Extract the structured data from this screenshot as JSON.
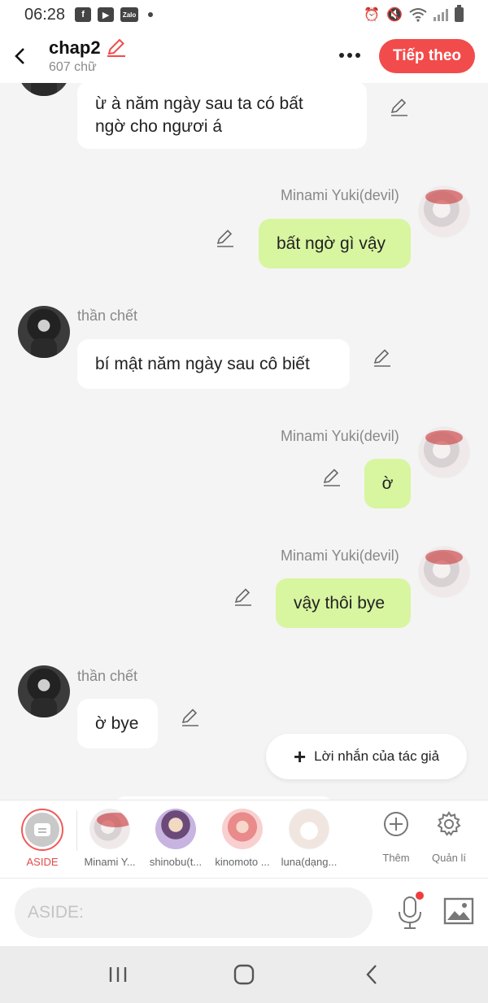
{
  "status_bar": {
    "time": "06:28",
    "apps": [
      "facebook-icon",
      "youtube-icon",
      "zalo-icon"
    ],
    "zalo_text": "Zalo"
  },
  "header": {
    "title": "chap2",
    "word_count": "607 chữ",
    "next_label": "Tiếp theo",
    "accent_color": "#f24b4b"
  },
  "messages": [
    {
      "side": "left",
      "sender": "",
      "text_line1": "ừ à năm ngày sau ta có bất",
      "text_line2": "ngờ cho ngươi á"
    },
    {
      "side": "right",
      "sender": "Minami Yuki(devil)",
      "text": "bất ngờ gì vậy"
    },
    {
      "side": "left",
      "sender": "thần chết",
      "text": "bí mật năm ngày sau cô biết"
    },
    {
      "side": "right",
      "sender": "Minami Yuki(devil)",
      "text": "ờ"
    },
    {
      "side": "right",
      "sender": "Minami Yuki(devil)",
      "text": "vậy thôi bye"
    },
    {
      "side": "left",
      "sender": "thần chết",
      "text": "ờ bye"
    }
  ],
  "author_note": {
    "label": "Lời nhắn của tác giả"
  },
  "character_bar": {
    "aside_label": "ASIDE",
    "characters": [
      {
        "name": "Minami Y..."
      },
      {
        "name": "shinobu(t..."
      },
      {
        "name": "kinomoto ..."
      },
      {
        "name": "luna(dạng..."
      }
    ],
    "add_label": "Thêm",
    "manage_label": "Quản lí"
  },
  "input": {
    "placeholder": "ASIDE:"
  },
  "colors": {
    "right_bubble": "#d8f5a0",
    "left_bubble": "#ffffff",
    "background": "#f4f4f4"
  }
}
